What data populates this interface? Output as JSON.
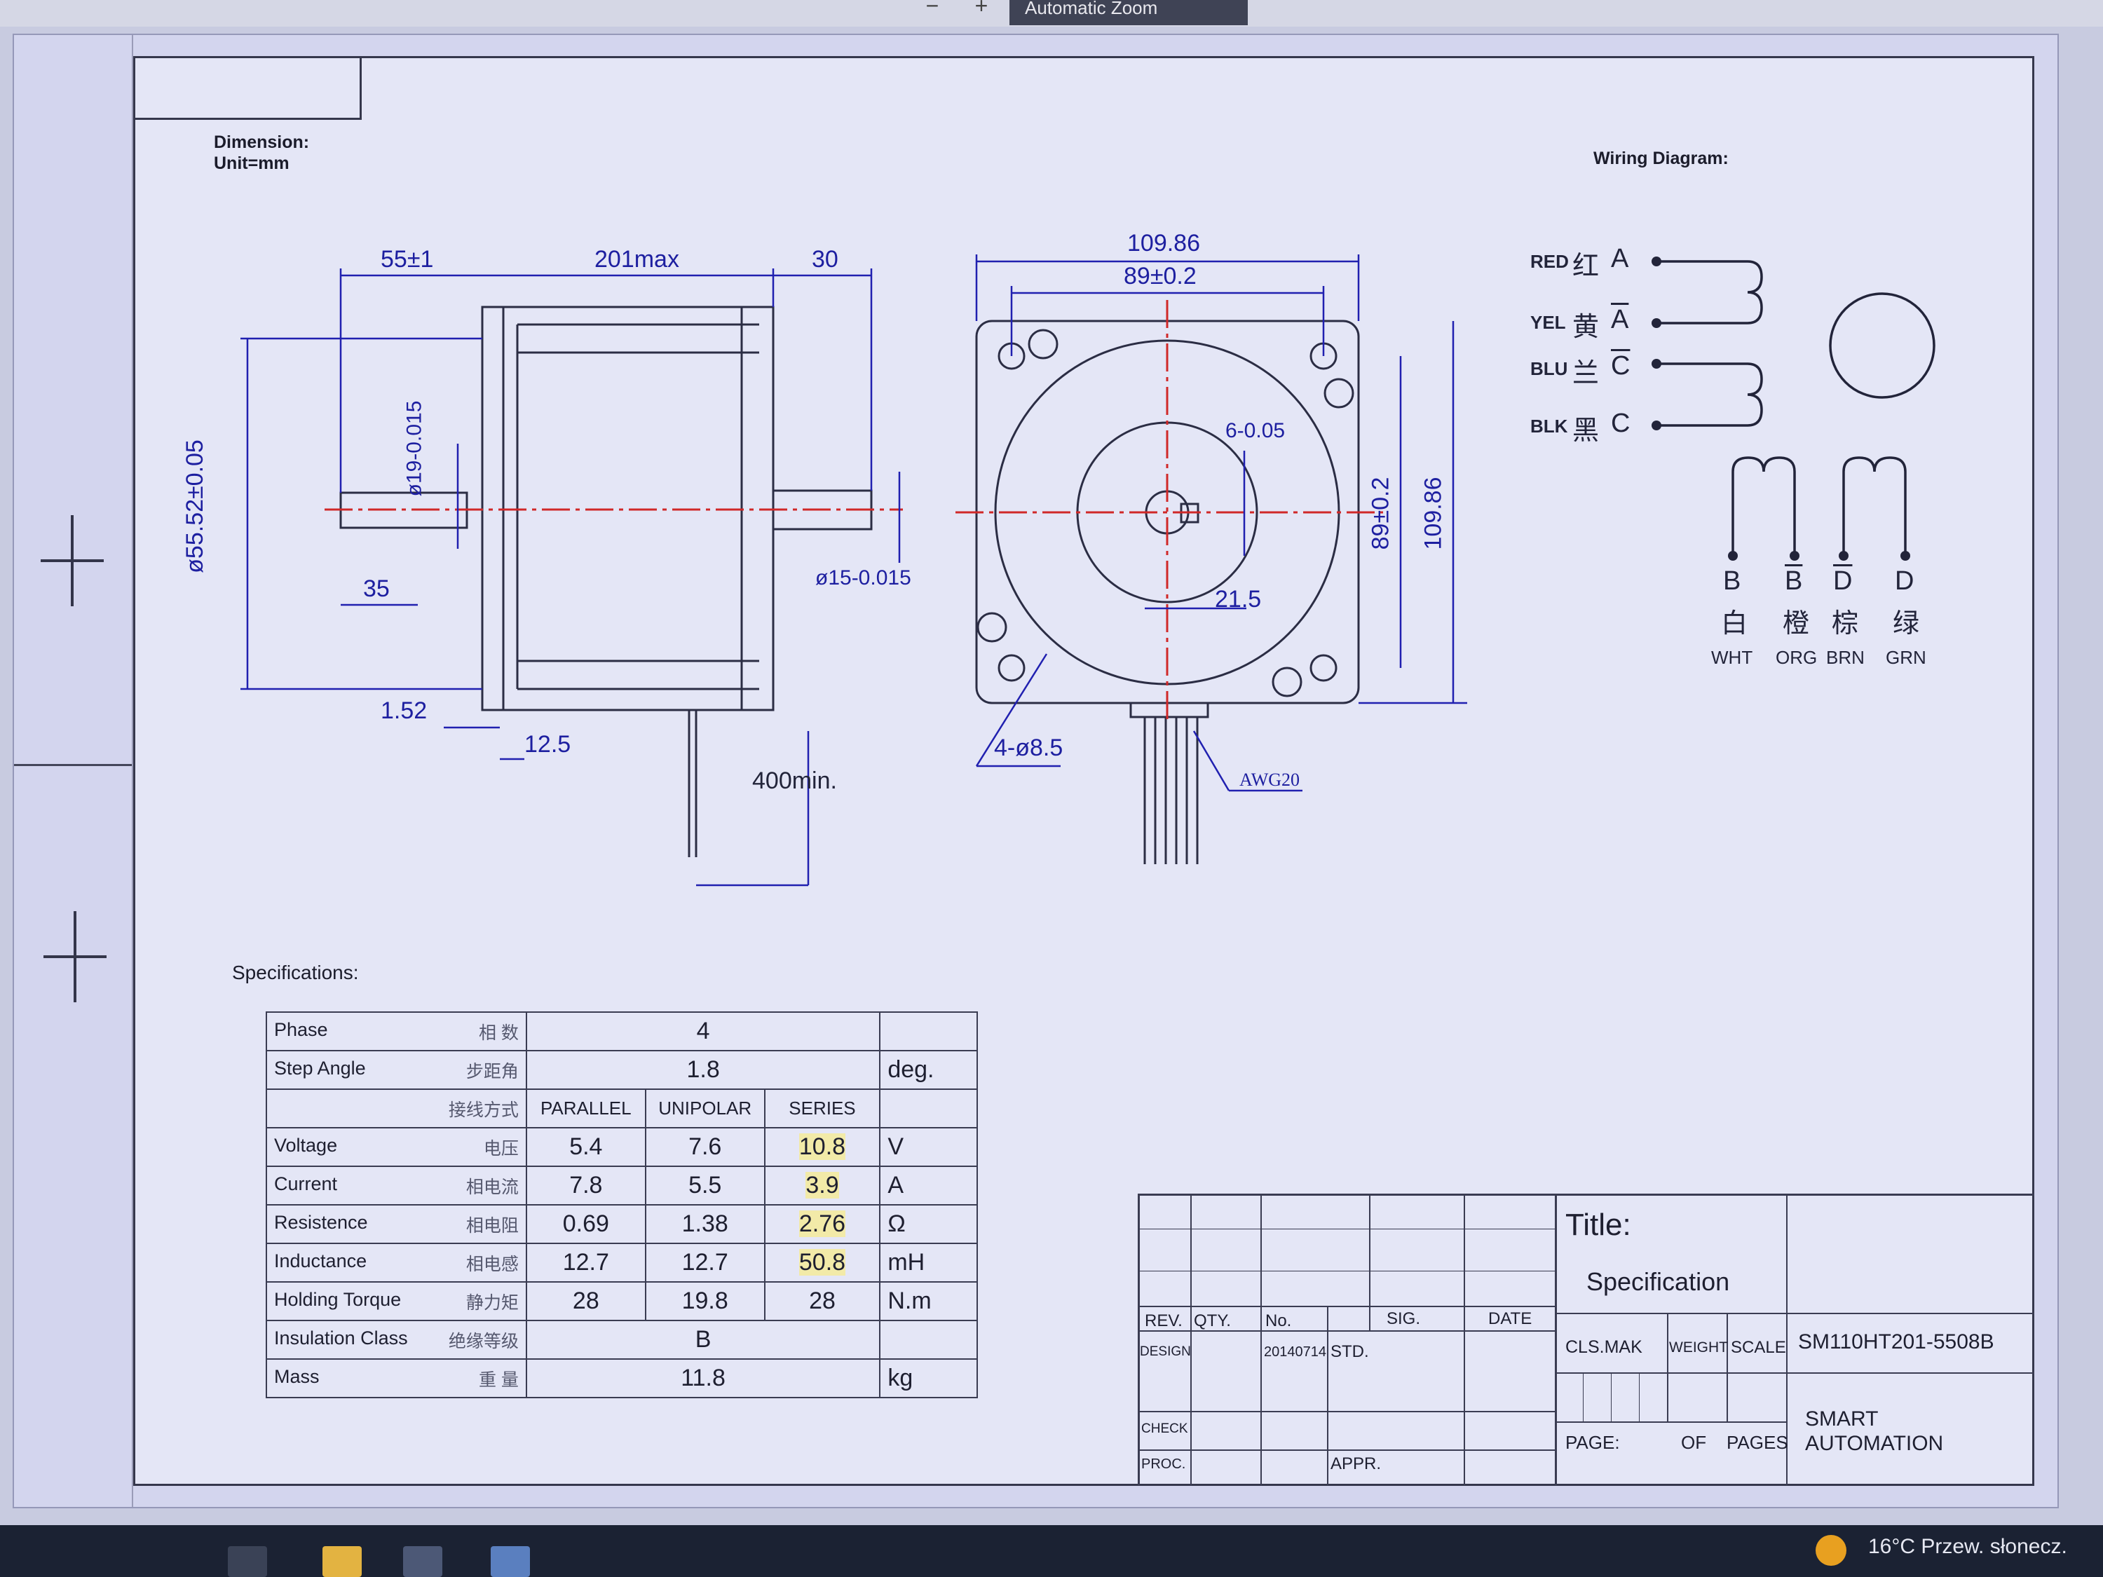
{
  "toolbar": {
    "zoom_label": "Automatic Zoom",
    "minus": "−",
    "plus": "+"
  },
  "sheet": {
    "dimension_label": "Dimension:",
    "unit_label": "Unit=mm",
    "wiring_label": "Wiring Diagram:",
    "specifications_label": "Specifications:"
  },
  "side_dims": {
    "d55": "55±1",
    "d201": "201max",
    "d30": "30",
    "dia55": "ø55.52±0.05",
    "dia19": "ø19-0.015",
    "d35": "35",
    "d152": "1.52",
    "d125": "12.5",
    "d400": "400min.",
    "dia15": "ø15-0.015"
  },
  "front_dims": {
    "w10986": "109.86",
    "w89": "89±0.2",
    "key6": "6-0.05",
    "d215": "21.5",
    "h89": "89±0.2",
    "h10986": "109.86",
    "holes": "4-ø8.5",
    "awg": "AWG20"
  },
  "wiring": {
    "leads": [
      {
        "en": "RED",
        "cn": "红",
        "phase": "A",
        "bar": false
      },
      {
        "en": "YEL",
        "cn": "黄",
        "phase": "A",
        "bar": true
      },
      {
        "en": "BLU",
        "cn": "兰",
        "phase": "C",
        "bar": true
      },
      {
        "en": "BLK",
        "cn": "黑",
        "phase": "C",
        "bar": false
      }
    ],
    "bottom": [
      {
        "phase": "B",
        "bar": false,
        "cn": "白",
        "en": "WHT"
      },
      {
        "phase": "B",
        "bar": true,
        "cn": "橙",
        "en": "ORG"
      },
      {
        "phase": "D",
        "bar": true,
        "cn": "棕",
        "en": "BRN"
      },
      {
        "phase": "D",
        "bar": false,
        "cn": "绿",
        "en": "GRN"
      }
    ]
  },
  "specs": {
    "rows": [
      {
        "en": "Phase",
        "cn": "相 数",
        "merged": "4",
        "unit": ""
      },
      {
        "en": "Step Angle",
        "cn": "步距角",
        "merged": "1.8",
        "unit": "deg."
      },
      {
        "en": "",
        "cn": "接线方式",
        "cols": [
          "PARALLEL",
          "UNIPOLAR",
          "SERIES"
        ],
        "unit": "",
        "header": true
      },
      {
        "en": "Voltage",
        "cn": "电压",
        "cols": [
          "5.4",
          "7.6",
          "10.8"
        ],
        "unit": "V"
      },
      {
        "en": "Current",
        "cn": "相电流",
        "cols": [
          "7.8",
          "5.5",
          "3.9"
        ],
        "unit": "A"
      },
      {
        "en": "Resistence",
        "cn": "相电阻",
        "cols": [
          "0.69",
          "1.38",
          "2.76"
        ],
        "unit": "Ω"
      },
      {
        "en": "Inductance",
        "cn": "相电感",
        "cols": [
          "12.7",
          "12.7",
          "50.8"
        ],
        "unit": "mH"
      },
      {
        "en": "Holding Torque",
        "cn": "静力矩",
        "cols": [
          "28",
          "19.8",
          "28"
        ],
        "unit": "N.m"
      },
      {
        "en": "Insulation Class",
        "cn": "绝缘等级",
        "merged": "B",
        "unit": ""
      },
      {
        "en": "Mass",
        "cn": "重 量",
        "merged": "11.8",
        "unit": "kg"
      }
    ]
  },
  "title_block": {
    "rev": "REV.",
    "qty": "QTY.",
    "no": "No.",
    "sig": "SIG.",
    "date": "DATE",
    "design": "DESIGN",
    "design_date": "20140714",
    "std": "STD.",
    "check": "CHECK",
    "proc": "PROC.",
    "appr": "APPR.",
    "title_label": "Title:",
    "title_value": "Specification",
    "cls_mak": "CLS.MAK",
    "weight": "WEIGHT",
    "scale": "SCALE",
    "part_no": "SM110HT201-5508B",
    "page": "PAGE:",
    "of": "OF",
    "pages": "PAGES",
    "company_line1": "SMART",
    "company_line2": "AUTOMATION"
  },
  "taskbar": {
    "weather": "16°C  Przew. słonecz."
  }
}
